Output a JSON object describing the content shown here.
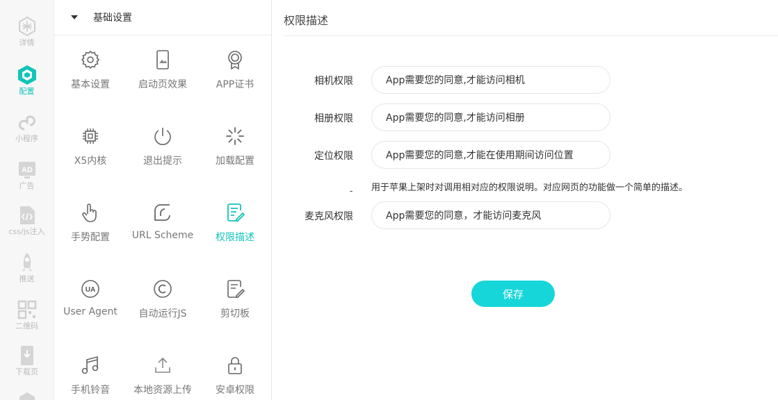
{
  "rail": {
    "items": [
      {
        "label": "详情",
        "icon": "web-globe-icon"
      },
      {
        "label": "配置",
        "icon": "cube-icon"
      },
      {
        "label": "小程序",
        "icon": "miniprogram-icon"
      },
      {
        "label": "广告",
        "icon": "ad-icon"
      },
      {
        "label": "css/js注入",
        "icon": "code-file-icon"
      },
      {
        "label": "推送",
        "icon": "rocket-icon"
      },
      {
        "label": "二维码",
        "icon": "qrcode-icon"
      },
      {
        "label": "下载页",
        "icon": "download-phone-icon"
      }
    ],
    "active_index": 1
  },
  "panel": {
    "section_title": "基础设置",
    "tiles": [
      {
        "label": "基本设置",
        "icon": "gear-icon"
      },
      {
        "label": "启动页效果",
        "icon": "splash-phone-icon"
      },
      {
        "label": "APP证书",
        "icon": "certificate-badge-icon"
      },
      {
        "label": "X5内核",
        "icon": "chip-icon"
      },
      {
        "label": "退出提示",
        "icon": "power-icon"
      },
      {
        "label": "加载配置",
        "icon": "loading-spinner-icon"
      },
      {
        "label": "手势配置",
        "icon": "hand-pointer-icon"
      },
      {
        "label": "URL Scheme",
        "icon": "url-scheme-icon"
      },
      {
        "label": "权限描述",
        "icon": "permission-doc-icon"
      },
      {
        "label": "User Agent",
        "icon": "ua-icon"
      },
      {
        "label": "自动运行JS",
        "icon": "copyright-c-icon"
      },
      {
        "label": "剪切板",
        "icon": "clipboard-edit-icon"
      },
      {
        "label": "手机铃音",
        "icon": "music-note-icon"
      },
      {
        "label": "本地资源上传",
        "icon": "upload-icon"
      },
      {
        "label": "安卓权限",
        "icon": "lock-icon"
      }
    ],
    "active_index": 8
  },
  "main": {
    "title": "权限描述",
    "rows": [
      {
        "label": "相机权限",
        "value": "App需要您的同意,才能访问相机"
      },
      {
        "label": "相册权限",
        "value": "App需要您的同意,才能访问相册"
      },
      {
        "label": "定位权限",
        "value": "App需要您的同意,才能在使用期间访问位置"
      },
      {
        "label": "麦克风权限",
        "value": "App需要您的同意，才能访问麦克风"
      }
    ],
    "hint": "用于苹果上架时对调用相对应的权限说明。对应网页的功能做一个简单的描述。",
    "hint_prefix": "-",
    "save_label": "保存"
  },
  "colors": {
    "accent": "#12c4b9",
    "button": "#17d6d9",
    "muted": "#bbbbbb"
  }
}
